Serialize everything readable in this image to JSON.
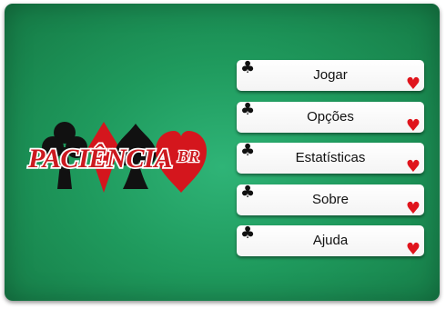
{
  "logo": {
    "text_main": "PACIÊNCIA",
    "text_suffix": "BR",
    "suits": [
      "club-icon",
      "diamond-icon",
      "spade-icon",
      "heart-icon"
    ],
    "colors": {
      "red": "#d4161d",
      "black": "#111111",
      "text_fill": "#cc1a20",
      "text_outline": "#ffffff"
    }
  },
  "menu": {
    "items": [
      {
        "label": "Jogar"
      },
      {
        "label": "Opções"
      },
      {
        "label": "Estatísticas"
      },
      {
        "label": "Sobre"
      },
      {
        "label": "Ajuda"
      }
    ],
    "left_icon": "club-icon",
    "right_icon": "heart-icon",
    "colors": {
      "club": "#111111",
      "heart": "#e0141c"
    }
  },
  "table": {
    "felt_color": "#1f9a5d"
  }
}
